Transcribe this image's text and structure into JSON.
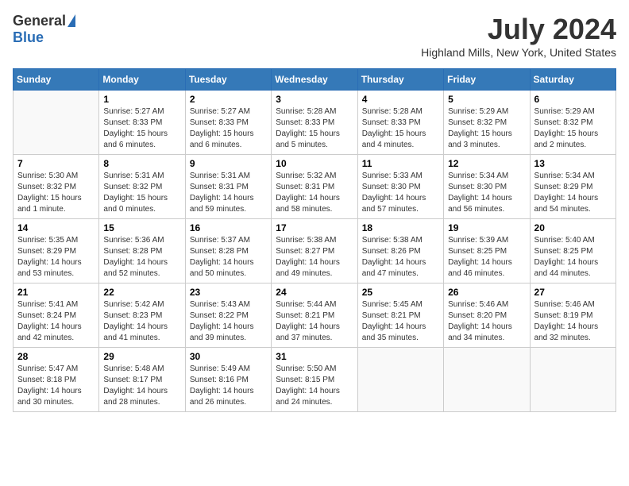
{
  "logo": {
    "general": "General",
    "blue": "Blue"
  },
  "title": "July 2024",
  "location": "Highland Mills, New York, United States",
  "days_of_week": [
    "Sunday",
    "Monday",
    "Tuesday",
    "Wednesday",
    "Thursday",
    "Friday",
    "Saturday"
  ],
  "weeks": [
    [
      {
        "day": "",
        "sunrise": "",
        "sunset": "",
        "daylight": "",
        "empty": true
      },
      {
        "day": "1",
        "sunrise": "Sunrise: 5:27 AM",
        "sunset": "Sunset: 8:33 PM",
        "daylight": "Daylight: 15 hours and 6 minutes."
      },
      {
        "day": "2",
        "sunrise": "Sunrise: 5:27 AM",
        "sunset": "Sunset: 8:33 PM",
        "daylight": "Daylight: 15 hours and 6 minutes."
      },
      {
        "day": "3",
        "sunrise": "Sunrise: 5:28 AM",
        "sunset": "Sunset: 8:33 PM",
        "daylight": "Daylight: 15 hours and 5 minutes."
      },
      {
        "day": "4",
        "sunrise": "Sunrise: 5:28 AM",
        "sunset": "Sunset: 8:33 PM",
        "daylight": "Daylight: 15 hours and 4 minutes."
      },
      {
        "day": "5",
        "sunrise": "Sunrise: 5:29 AM",
        "sunset": "Sunset: 8:32 PM",
        "daylight": "Daylight: 15 hours and 3 minutes."
      },
      {
        "day": "6",
        "sunrise": "Sunrise: 5:29 AM",
        "sunset": "Sunset: 8:32 PM",
        "daylight": "Daylight: 15 hours and 2 minutes."
      }
    ],
    [
      {
        "day": "7",
        "sunrise": "Sunrise: 5:30 AM",
        "sunset": "Sunset: 8:32 PM",
        "daylight": "Daylight: 15 hours and 1 minute."
      },
      {
        "day": "8",
        "sunrise": "Sunrise: 5:31 AM",
        "sunset": "Sunset: 8:32 PM",
        "daylight": "Daylight: 15 hours and 0 minutes."
      },
      {
        "day": "9",
        "sunrise": "Sunrise: 5:31 AM",
        "sunset": "Sunset: 8:31 PM",
        "daylight": "Daylight: 14 hours and 59 minutes."
      },
      {
        "day": "10",
        "sunrise": "Sunrise: 5:32 AM",
        "sunset": "Sunset: 8:31 PM",
        "daylight": "Daylight: 14 hours and 58 minutes."
      },
      {
        "day": "11",
        "sunrise": "Sunrise: 5:33 AM",
        "sunset": "Sunset: 8:30 PM",
        "daylight": "Daylight: 14 hours and 57 minutes."
      },
      {
        "day": "12",
        "sunrise": "Sunrise: 5:34 AM",
        "sunset": "Sunset: 8:30 PM",
        "daylight": "Daylight: 14 hours and 56 minutes."
      },
      {
        "day": "13",
        "sunrise": "Sunrise: 5:34 AM",
        "sunset": "Sunset: 8:29 PM",
        "daylight": "Daylight: 14 hours and 54 minutes."
      }
    ],
    [
      {
        "day": "14",
        "sunrise": "Sunrise: 5:35 AM",
        "sunset": "Sunset: 8:29 PM",
        "daylight": "Daylight: 14 hours and 53 minutes."
      },
      {
        "day": "15",
        "sunrise": "Sunrise: 5:36 AM",
        "sunset": "Sunset: 8:28 PM",
        "daylight": "Daylight: 14 hours and 52 minutes."
      },
      {
        "day": "16",
        "sunrise": "Sunrise: 5:37 AM",
        "sunset": "Sunset: 8:28 PM",
        "daylight": "Daylight: 14 hours and 50 minutes."
      },
      {
        "day": "17",
        "sunrise": "Sunrise: 5:38 AM",
        "sunset": "Sunset: 8:27 PM",
        "daylight": "Daylight: 14 hours and 49 minutes."
      },
      {
        "day": "18",
        "sunrise": "Sunrise: 5:38 AM",
        "sunset": "Sunset: 8:26 PM",
        "daylight": "Daylight: 14 hours and 47 minutes."
      },
      {
        "day": "19",
        "sunrise": "Sunrise: 5:39 AM",
        "sunset": "Sunset: 8:25 PM",
        "daylight": "Daylight: 14 hours and 46 minutes."
      },
      {
        "day": "20",
        "sunrise": "Sunrise: 5:40 AM",
        "sunset": "Sunset: 8:25 PM",
        "daylight": "Daylight: 14 hours and 44 minutes."
      }
    ],
    [
      {
        "day": "21",
        "sunrise": "Sunrise: 5:41 AM",
        "sunset": "Sunset: 8:24 PM",
        "daylight": "Daylight: 14 hours and 42 minutes."
      },
      {
        "day": "22",
        "sunrise": "Sunrise: 5:42 AM",
        "sunset": "Sunset: 8:23 PM",
        "daylight": "Daylight: 14 hours and 41 minutes."
      },
      {
        "day": "23",
        "sunrise": "Sunrise: 5:43 AM",
        "sunset": "Sunset: 8:22 PM",
        "daylight": "Daylight: 14 hours and 39 minutes."
      },
      {
        "day": "24",
        "sunrise": "Sunrise: 5:44 AM",
        "sunset": "Sunset: 8:21 PM",
        "daylight": "Daylight: 14 hours and 37 minutes."
      },
      {
        "day": "25",
        "sunrise": "Sunrise: 5:45 AM",
        "sunset": "Sunset: 8:21 PM",
        "daylight": "Daylight: 14 hours and 35 minutes."
      },
      {
        "day": "26",
        "sunrise": "Sunrise: 5:46 AM",
        "sunset": "Sunset: 8:20 PM",
        "daylight": "Daylight: 14 hours and 34 minutes."
      },
      {
        "day": "27",
        "sunrise": "Sunrise: 5:46 AM",
        "sunset": "Sunset: 8:19 PM",
        "daylight": "Daylight: 14 hours and 32 minutes."
      }
    ],
    [
      {
        "day": "28",
        "sunrise": "Sunrise: 5:47 AM",
        "sunset": "Sunset: 8:18 PM",
        "daylight": "Daylight: 14 hours and 30 minutes."
      },
      {
        "day": "29",
        "sunrise": "Sunrise: 5:48 AM",
        "sunset": "Sunset: 8:17 PM",
        "daylight": "Daylight: 14 hours and 28 minutes."
      },
      {
        "day": "30",
        "sunrise": "Sunrise: 5:49 AM",
        "sunset": "Sunset: 8:16 PM",
        "daylight": "Daylight: 14 hours and 26 minutes."
      },
      {
        "day": "31",
        "sunrise": "Sunrise: 5:50 AM",
        "sunset": "Sunset: 8:15 PM",
        "daylight": "Daylight: 14 hours and 24 minutes."
      },
      {
        "day": "",
        "sunrise": "",
        "sunset": "",
        "daylight": "",
        "empty": true
      },
      {
        "day": "",
        "sunrise": "",
        "sunset": "",
        "daylight": "",
        "empty": true
      },
      {
        "day": "",
        "sunrise": "",
        "sunset": "",
        "daylight": "",
        "empty": true
      }
    ]
  ]
}
